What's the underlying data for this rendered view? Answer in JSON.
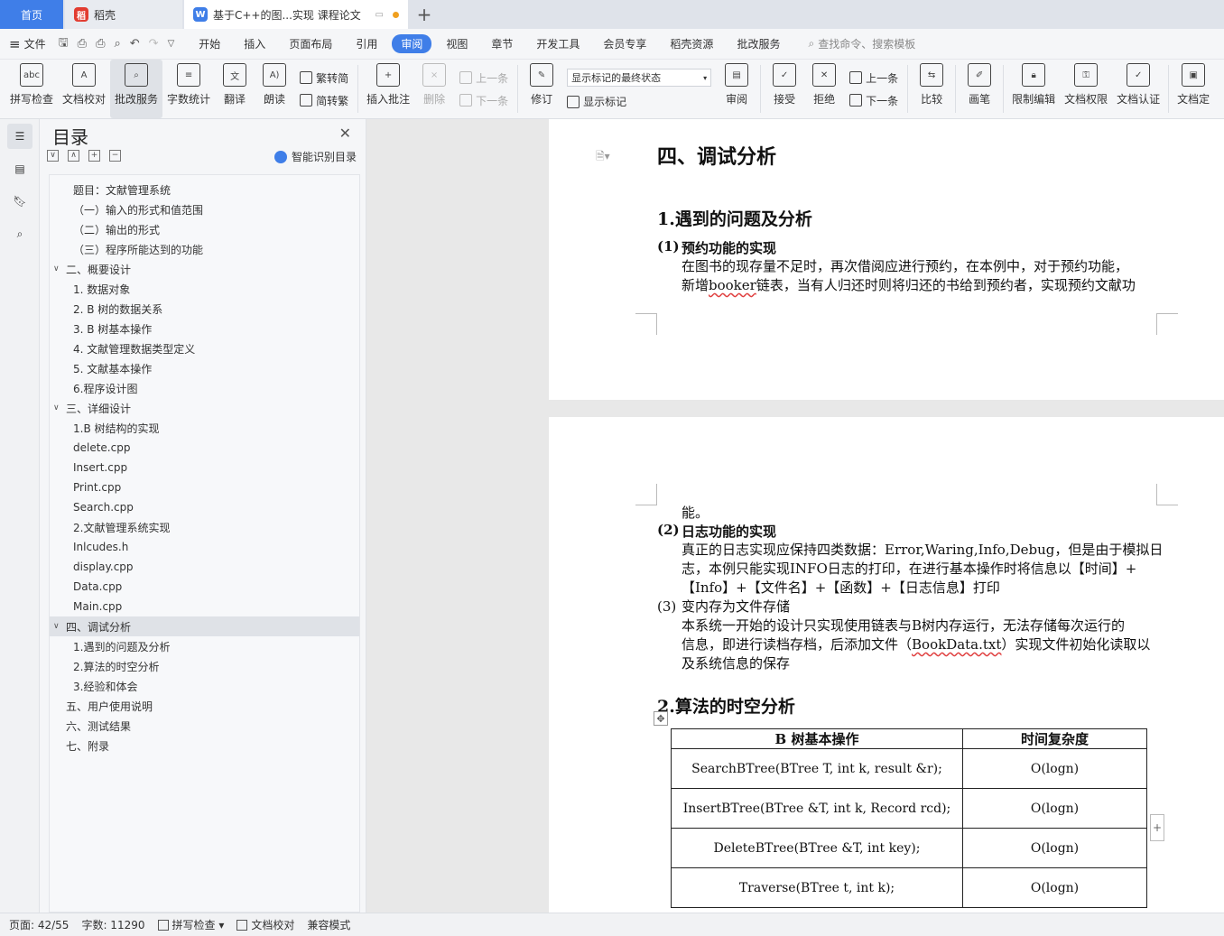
{
  "tabs": {
    "home": "首页",
    "daoke": "稻壳",
    "doc": "基于C++的图...实现 课程论文",
    "add": "+"
  },
  "menu": {
    "file": "文件",
    "items": [
      "开始",
      "插入",
      "页面布局",
      "引用",
      "审阅",
      "视图",
      "章节",
      "开发工具",
      "会员专享",
      "稻壳资源",
      "批改服务"
    ],
    "active": "审阅",
    "search": "查找命令、搜索模板"
  },
  "ribbon": {
    "spell": "拼写检查",
    "proof": "文档校对",
    "review_service": "批改服务",
    "word_count": "字数统计",
    "translate": "翻译",
    "read_aloud": "朗读",
    "trad_to_simp": "繁转简",
    "simp_to_trad": "简转繁",
    "insert_comment": "插入批注",
    "delete": "删除",
    "prev": "上一条",
    "next": "下一条",
    "revise": "修订",
    "markup_state": "显示标记的最终状态",
    "show_markup": "显示标记",
    "review": "审阅",
    "accept": "接受",
    "reject": "拒绝",
    "prev2": "上一条",
    "next2": "下一条",
    "compare": "比较",
    "pen": "画笔",
    "restrict_edit": "限制编辑",
    "doc_perm": "文档权限",
    "doc_cert": "文档认证",
    "doc_final": "文档定"
  },
  "toc": {
    "title": "目录",
    "smart": "智能识别目录",
    "items": [
      {
        "text": "题目：文献管理系统",
        "indent": 2,
        "caret": ""
      },
      {
        "text": "（一）输入的形式和值范围",
        "indent": 2,
        "caret": ""
      },
      {
        "text": "（二）输出的形式",
        "indent": 2,
        "caret": ""
      },
      {
        "text": "（三）程序所能达到的功能",
        "indent": 2,
        "caret": ""
      },
      {
        "text": "二、概要设计",
        "indent": 1,
        "caret": "∨"
      },
      {
        "text": "1. 数据对象",
        "indent": 2,
        "caret": ""
      },
      {
        "text": "2. B 树的数据关系",
        "indent": 2,
        "caret": ""
      },
      {
        "text": "3. B 树基本操作",
        "indent": 2,
        "caret": ""
      },
      {
        "text": "4. 文献管理数据类型定义",
        "indent": 2,
        "caret": ""
      },
      {
        "text": "5. 文献基本操作",
        "indent": 2,
        "caret": ""
      },
      {
        "text": "6.程序设计图",
        "indent": 2,
        "caret": ""
      },
      {
        "text": "三、详细设计",
        "indent": 1,
        "caret": "∨"
      },
      {
        "text": "1.B 树结构的实现",
        "indent": 2,
        "caret": ""
      },
      {
        "text": "delete.cpp",
        "indent": 2,
        "caret": ""
      },
      {
        "text": "Insert.cpp",
        "indent": 2,
        "caret": ""
      },
      {
        "text": "Print.cpp",
        "indent": 2,
        "caret": ""
      },
      {
        "text": "Search.cpp",
        "indent": 2,
        "caret": ""
      },
      {
        "text": "2.文献管理系统实现",
        "indent": 2,
        "caret": ""
      },
      {
        "text": "Inlcudes.h",
        "indent": 2,
        "caret": ""
      },
      {
        "text": "display.cpp",
        "indent": 2,
        "caret": ""
      },
      {
        "text": "Data.cpp",
        "indent": 2,
        "caret": ""
      },
      {
        "text": "Main.cpp",
        "indent": 2,
        "caret": ""
      },
      {
        "text": "四、调试分析",
        "indent": 1,
        "caret": "∨",
        "selected": true
      },
      {
        "text": "1.遇到的问题及分析",
        "indent": 2,
        "caret": ""
      },
      {
        "text": "2.算法的时空分析",
        "indent": 2,
        "caret": ""
      },
      {
        "text": "3.经验和体会",
        "indent": 2,
        "caret": ""
      },
      {
        "text": "五、用户使用说明",
        "indent": 1,
        "caret": ""
      },
      {
        "text": "六、测试结果",
        "indent": 1,
        "caret": ""
      },
      {
        "text": "七、附录",
        "indent": 1,
        "caret": ""
      }
    ]
  },
  "doc": {
    "chapter": "四、调试分析",
    "sec1": "1.遇到的问题及分析",
    "item1_num": "(1)",
    "item1_title": "预约功能的实现",
    "item1_l1": "在图书的现存量不足时，再次借阅应进行预约，在本例中，对于预约功能，",
    "item1_l2a": "新增",
    "item1_l2_word": "booker",
    "item1_l2b": "链表，当有人归还时则将归还的书给到预约者，实现预约文献功",
    "item1_l3": "能。",
    "item2_num": "(2)",
    "item2_title": "日志功能的实现",
    "item2_l1": "真正的日志实现应保持四类数据：Error,Waring,Info,Debug，但是由于模拟日",
    "item2_l2": "志，本例只能实现INFO日志的打印，在进行基本操作时将信息以【时间】+",
    "item2_l3": "【Info】+【文件名】+【函数】+【日志信息】打印",
    "item3_num": "(3)",
    "item3_title": "变内存为文件存储",
    "item3_l1": "本系统一开始的设计只实现使用链表与B树内存运行，无法存储每次运行的",
    "item3_l2a": "信息，即进行读档存档，后添加文件（",
    "item3_l2_word": "BookData.txt",
    "item3_l2b": "）实现文件初始化读取以",
    "item3_l3": "及系统信息的保存",
    "sec2": "2.算法的时空分析",
    "table_head": [
      "B 树基本操作",
      "时间复杂度"
    ],
    "table_rows": [
      [
        "SearchBTree(BTree T, int k, result &r);",
        "O(logn)"
      ],
      [
        "InsertBTree(BTree &T, int k, Record rcd);",
        "O(logn)"
      ],
      [
        "DeleteBTree(BTree &T, int key);",
        "O(logn)"
      ],
      [
        "Traverse(BTree t, int k);",
        "O(logn)"
      ]
    ]
  },
  "status": {
    "page": "页面: 42/55",
    "words": "字数: 11290",
    "spell": "拼写检查",
    "proof": "文档校对",
    "compat": "兼容模式"
  }
}
